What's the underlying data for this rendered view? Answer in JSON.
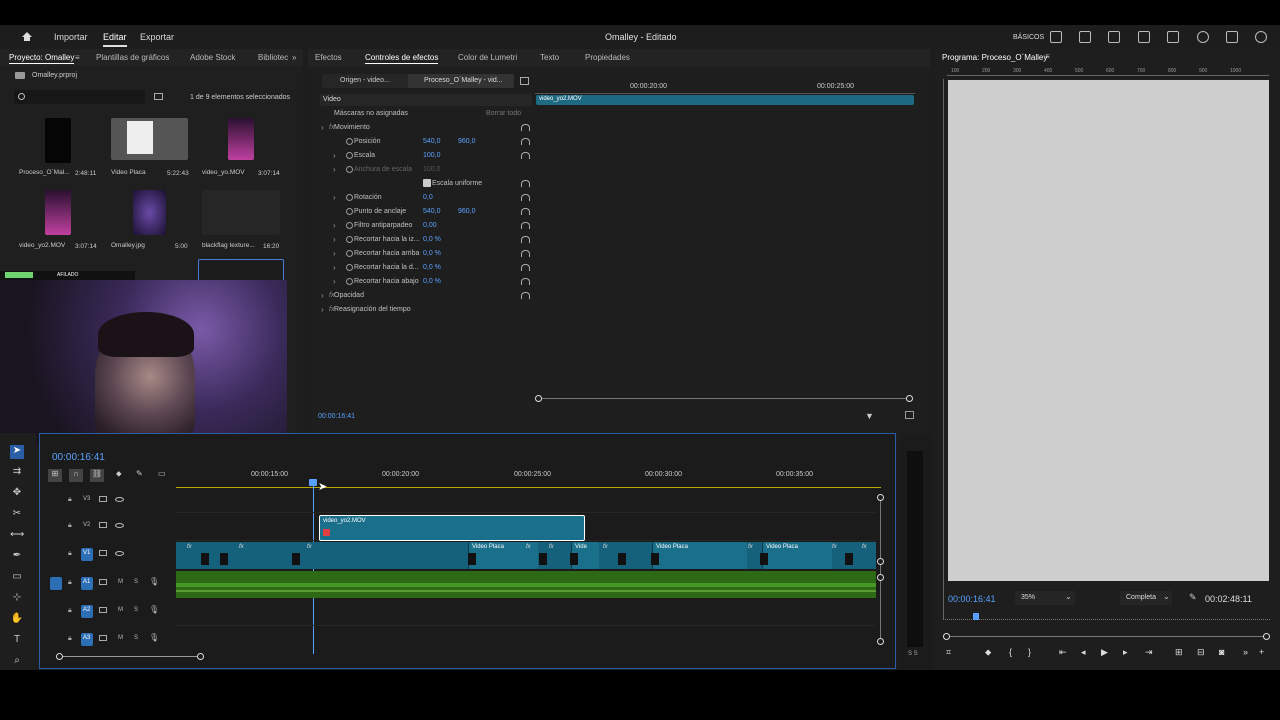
{
  "topbar": {
    "items": [
      "Importar",
      "Editar",
      "Exportar"
    ],
    "title": "Omalley - Editado",
    "workspace": "BÁSICOS"
  },
  "project": {
    "tabs": [
      "Proyecto: Omalley",
      "Plantillas de gráficos",
      "Adobe Stock",
      "Bibliotec"
    ],
    "file": "Omalley.prproj",
    "count": "1 de 9 elementos seleccionados",
    "items": [
      {
        "name": "Proceso_O´Mal...",
        "dur": "2:48:11"
      },
      {
        "name": "Video Placa",
        "dur": "5:22:43"
      },
      {
        "name": "video_yo.MOV",
        "dur": "3:07:14"
      },
      {
        "name": "video_yo2.MOV",
        "dur": "3:07:14"
      },
      {
        "name": "Omalley.jpg",
        "dur": "5:00"
      },
      {
        "name": "blackflag texture...",
        "dur": "16:20"
      }
    ],
    "strip_label": "AFILADO"
  },
  "effects": {
    "tabs": [
      "Efectos",
      "Controles de efectos",
      "Color de Lumetri",
      "Texto",
      "Propiedades"
    ],
    "sources": [
      "Origen - video...",
      "Proceso_O´Malley - vid..."
    ],
    "section": "Video",
    "masks": "Máscaras no asignadas",
    "clear": "Borrar todo",
    "rows": [
      {
        "label": "Movimiento",
        "v1": "",
        "v2": ""
      },
      {
        "label": "Posición",
        "v1": "540,0",
        "v2": "960,0"
      },
      {
        "label": "Escala",
        "v1": "100,0",
        "v2": ""
      },
      {
        "label": "Anchura de escala",
        "v1": "100,0",
        "v2": ""
      },
      {
        "label": "Escala uniforme",
        "v1": "",
        "v2": ""
      },
      {
        "label": "Rotación",
        "v1": "0,0",
        "v2": ""
      },
      {
        "label": "Punto de anclaje",
        "v1": "540,0",
        "v2": "960,0"
      },
      {
        "label": "Filtro antiparpadeo",
        "v1": "0,00",
        "v2": ""
      },
      {
        "label": "Recortar hacia la iz...",
        "v1": "0,0 %",
        "v2": ""
      },
      {
        "label": "Recortar hacia arriba",
        "v1": "0,0 %",
        "v2": ""
      },
      {
        "label": "Recortar hacia la d...",
        "v1": "0,0 %",
        "v2": ""
      },
      {
        "label": "Recortar hacia abajo",
        "v1": "0,0 %",
        "v2": ""
      },
      {
        "label": "Opacidad",
        "v1": "",
        "v2": ""
      },
      {
        "label": "Reasignación del tiempo",
        "v1": "",
        "v2": ""
      }
    ],
    "ruler": [
      "00:00:20:00",
      "00:00:25:00"
    ],
    "clip": "video_yo2.MOV",
    "timecode": "00:00:16:41"
  },
  "program": {
    "title": "Programa: Proceso_O´Malley",
    "ruler": [
      "100",
      "200",
      "300",
      "400",
      "500",
      "600",
      "700",
      "800",
      "900",
      "1000"
    ],
    "timecode": "00:00:16:41",
    "zoom": "35%",
    "quality": "Completa",
    "duration": "00:02:48:11"
  },
  "timeline": {
    "timecode": "00:00:16:41",
    "ruler": [
      "00:00:15:00",
      "00:00:20:00",
      "00:00:25:00",
      "00:00:30:00",
      "00:00:35:00"
    ],
    "tracks": [
      "V3",
      "V2",
      "V1",
      "A1",
      "A2",
      "A3"
    ],
    "clips": {
      "v2": "video_yo2.MOV",
      "v1": [
        "Video Placa",
        "Vide",
        "Video Placa",
        "Video Placa"
      ]
    },
    "mute": "M",
    "solo": "S"
  },
  "meter": {
    "label": "S S"
  }
}
